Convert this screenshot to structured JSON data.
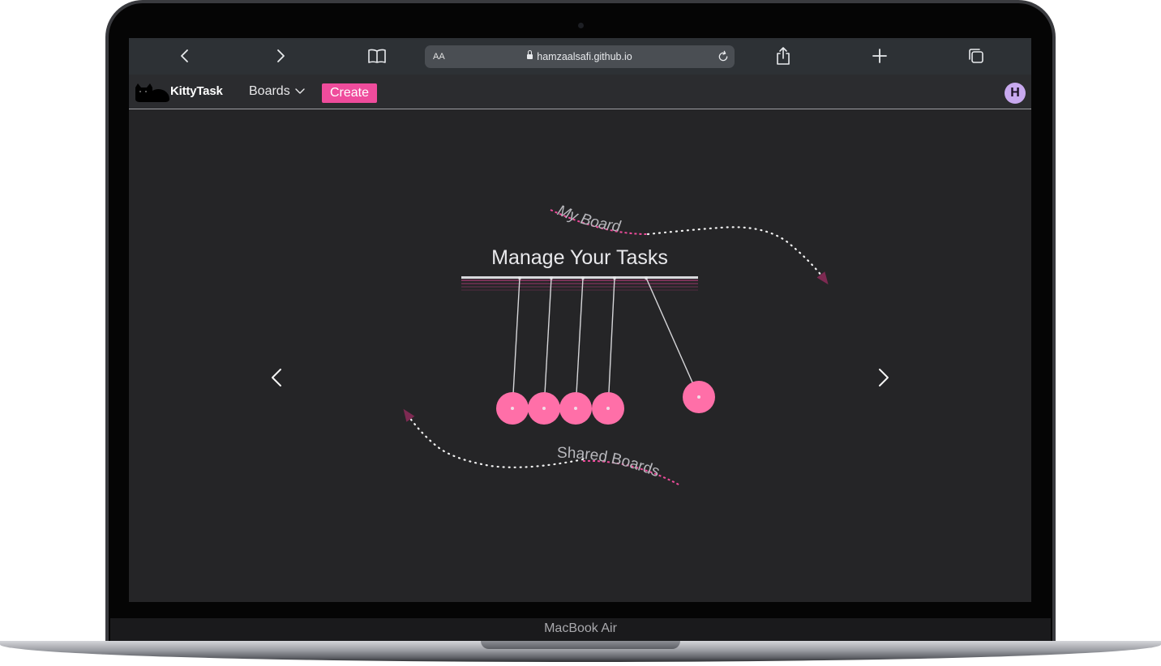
{
  "device": {
    "label": "MacBook Air"
  },
  "browser": {
    "url_host": "hamzaalsafi.github.io",
    "text_size_label": "AA",
    "icons": [
      "back-icon",
      "forward-icon",
      "bookmarks-icon",
      "reload-icon",
      "share-icon",
      "new-tab-icon",
      "tabs-icon"
    ]
  },
  "nav": {
    "brand": "KittyTask",
    "boards_label": "Boards",
    "create_label": "Create",
    "avatar_initial": "H"
  },
  "hero": {
    "title": "Manage Your Tasks",
    "top_link": "My Board",
    "bottom_link": "Shared Boards"
  },
  "colors": {
    "accent": "#ef4c9c",
    "ball": "#ff6fa8",
    "avatar": "#c8a9ef",
    "background": "#252527"
  }
}
